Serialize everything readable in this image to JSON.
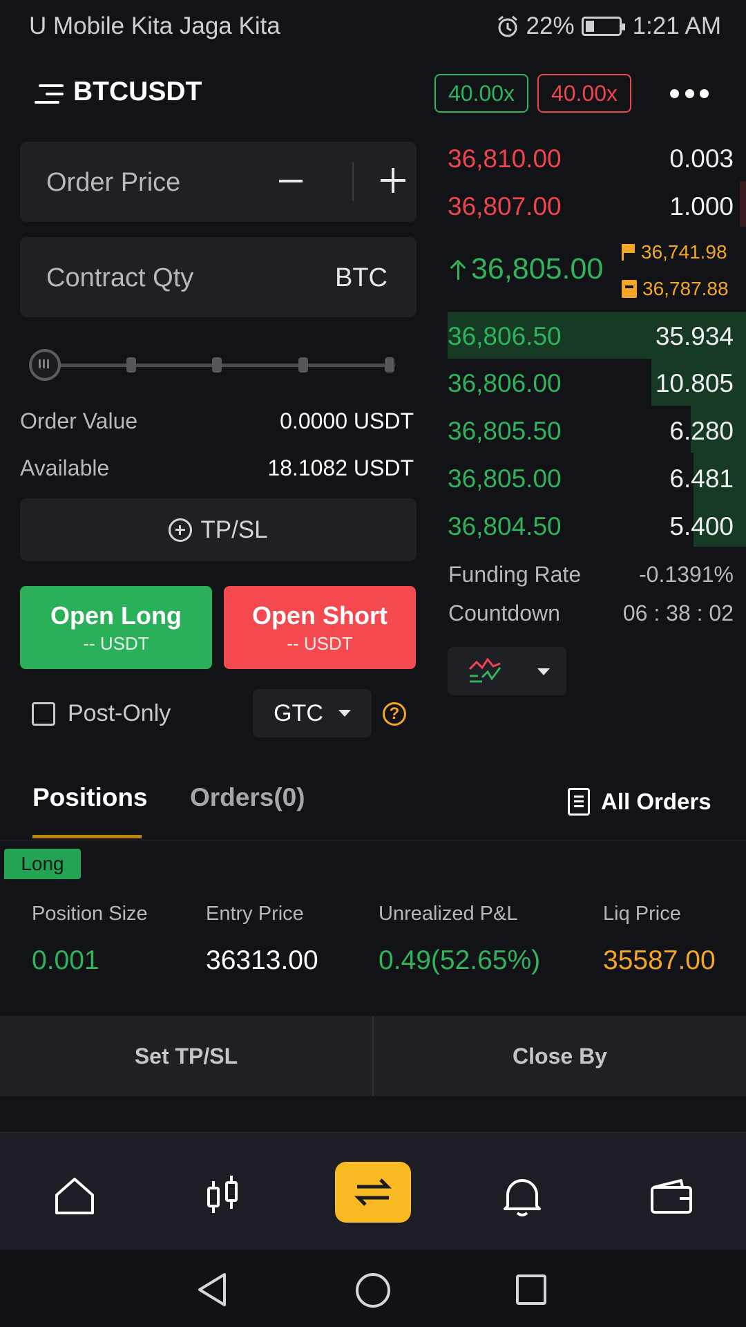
{
  "status_bar": {
    "carrier": "U Mobile Kita Jaga Kita",
    "battery": "22%",
    "time": "1:21 AM"
  },
  "header": {
    "symbol": "BTCUSDT",
    "leverage_long": "40.00x",
    "leverage_short": "40.00x",
    "menu_icon": "hamburger-icon",
    "more_icon": "more-dots-icon"
  },
  "order_form": {
    "order_price_label": "Order Price",
    "contract_qty_label": "Contract Qty",
    "contract_qty_unit": "BTC",
    "slider_level": 0,
    "order_value_label": "Order Value",
    "order_value": "0.0000 USDT",
    "available_label": "Available",
    "available": "18.1082 USDT",
    "tpsl_label": "TP/SL",
    "open_long_label": "Open Long",
    "open_long_sub": "-- USDT",
    "open_short_label": "Open Short",
    "open_short_sub": "-- USDT",
    "post_only_label": "Post-Only",
    "post_only_checked": false,
    "tif_value": "GTC"
  },
  "order_book": {
    "asks": [
      {
        "price": "36,810.00",
        "qty": "0.003"
      },
      {
        "price": "36,807.00",
        "qty": "1.000"
      }
    ],
    "last_price": "36,805.00",
    "mark_price_1": "36,741.98",
    "mark_price_2": "36,787.88",
    "bids": [
      {
        "price": "36,806.50",
        "qty": "35.934"
      },
      {
        "price": "36,806.00",
        "qty": "10.805"
      },
      {
        "price": "36,805.50",
        "qty": "6.280"
      },
      {
        "price": "36,805.00",
        "qty": "6.481"
      },
      {
        "price": "36,804.50",
        "qty": "5.400"
      }
    ],
    "funding_rate_label": "Funding Rate",
    "funding_rate": "-0.1391%",
    "countdown_label": "Countdown",
    "countdown": "06 : 38 : 02"
  },
  "tabs": {
    "positions": "Positions",
    "orders": "Orders(0)",
    "all_orders": "All Orders"
  },
  "position": {
    "side": "Long",
    "size_label": "Position Size",
    "size": "0.001",
    "entry_label": "Entry Price",
    "entry": "36313.00",
    "pnl_label": "Unrealized P&L",
    "pnl": "0.49(52.65%)",
    "liq_label": "Liq Price",
    "liq": "35587.00",
    "set_tpsl": "Set TP/SL",
    "close_by": "Close By"
  },
  "colors": {
    "green": "#2fb35c",
    "red": "#f0454e",
    "accent": "#f8b923",
    "background": "#121317"
  },
  "bottom_nav": [
    "home-icon",
    "candlestick-chart-icon",
    "trade-swap-icon",
    "bell-icon",
    "wallet-icon"
  ]
}
